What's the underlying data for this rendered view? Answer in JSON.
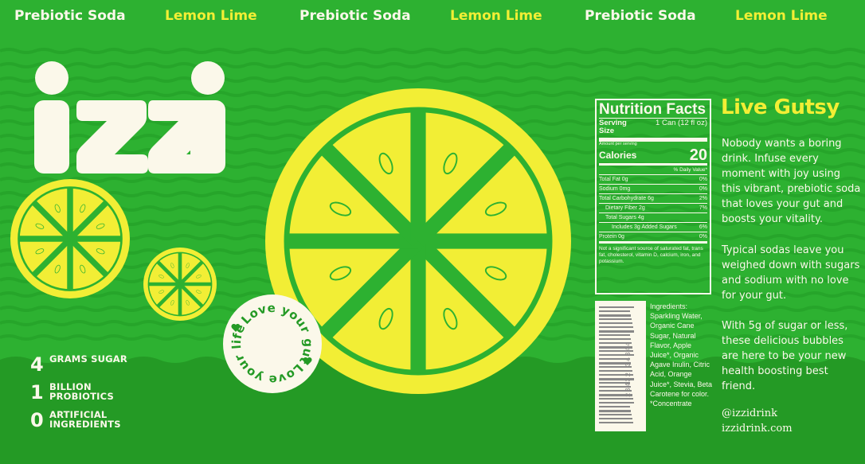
{
  "header_strip": [
    "Prebiotic Soda",
    "Lemon Lime",
    "Prebiotic Soda",
    "Lemon Lime",
    "Prebiotic Soda",
    "Lemon Lime"
  ],
  "brand": "izzi",
  "badge_text_1": "Love your gut",
  "badge_text_2": "Love your life",
  "stats": [
    {
      "num": "4",
      "label": "GRAMS SUGAR"
    },
    {
      "num": "1",
      "label": "BILLION PROBIOTICS"
    },
    {
      "num": "0",
      "label": "ARTIFICIAL INGREDIENTS"
    }
  ],
  "nutrition": {
    "title": "Nutrition Facts",
    "serving_label": "Serving Size",
    "serving_value": "1 Can (12 fl oz)",
    "amount_per": "Amount per serving",
    "calories_label": "Calories",
    "calories_value": "20",
    "dv_header": "% Daily Value*",
    "rows": [
      {
        "label": "Total Fat 0g",
        "dv": "0%"
      },
      {
        "label": "Sodium 0mg",
        "dv": "0%"
      },
      {
        "label": "Total Carbohydrate 6g",
        "dv": "2%"
      },
      {
        "label": "Dietary Fiber 2g",
        "dv": "7%"
      },
      {
        "label": "Total Sugars 4g",
        "dv": ""
      },
      {
        "label": "Includes 3g Added Sugars",
        "dv": "6%"
      },
      {
        "label": "Protein 0g",
        "dv": "0%"
      }
    ],
    "footnote": "Not a significant source of saturated fat, trans fat, cholesterol, vitamin D, calcium, iron, and potassium."
  },
  "barcode_number": "23432 34344",
  "ingredients": "Ingredients: Sparkling Water, Organic Cane Sugar, Natural Flavor, Apple Juice*, Organic Agave Inulin, Citric Acid, Orange Juice*, Stevia, Beta Carotene for color. *Concentrate",
  "headline": "Live Gutsy",
  "paragraphs": [
    "Nobody wants a boring drink. Infuse every moment with joy using this vibrant, prebiotic soda that loves your gut and boosts your vitality.",
    "Typical sodas leave you weighed down with sugars and sodium with no love for your gut.",
    "With 5g of sugar or less, these delicious bubbles are here to be your new health boosting best friend."
  ],
  "social_handle": "@izzidrink",
  "website": "izzidrink.com",
  "colors": {
    "green": "#2db131",
    "dark_green": "#249a25",
    "wave_green": "#26a52a",
    "yellow": "#f2ee35",
    "cream": "#fbf8ea"
  }
}
